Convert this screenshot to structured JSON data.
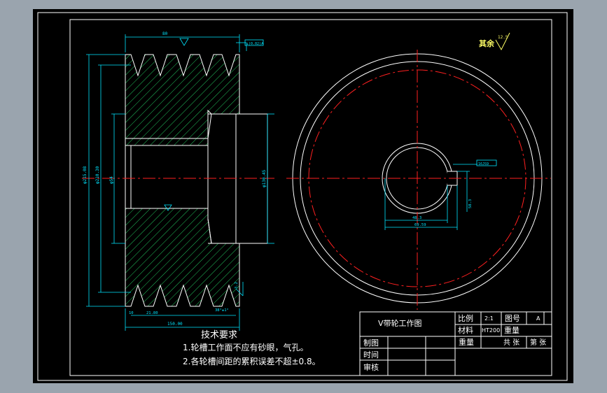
{
  "colors": {
    "background": "#9aa4ae",
    "sheet": "#000000",
    "line": "#ffffff",
    "dimension": "#00e5ff",
    "center": "#ff2020",
    "hatch": "#22c55e",
    "text": "#ffffff"
  },
  "roughness_note": "其余",
  "roughness_value": "12.5",
  "tech_requirements": {
    "title": "技术要求",
    "items": [
      "1.轮槽工作面不应有砂眼，气孔。",
      "2.各轮槽间距的累积误差不超±0.8。"
    ]
  },
  "title_block": {
    "title": "V带轮工作图",
    "scale_label": "比例",
    "scale_value": "2:1",
    "drawing_no_label": "图号",
    "drawing_no_value": "A",
    "material_label": "材料",
    "material_value": "HT200",
    "weight_label": "重量",
    "weight_label_2": "重量",
    "total_sheets": "共 张",
    "sheet_no": "第 张",
    "drawn_label": "制图",
    "date_label": "时间",
    "review_label": "审核"
  },
  "dimensions": {
    "top_width": "80",
    "od": "φ215.08",
    "pitch_d": "φ210.30",
    "hub_d": "φ130.45",
    "bore_d": "φ54",
    "groove_pitch": "21.80",
    "groove_edge": "10",
    "width_total": "150.00",
    "tol_block": "⊥|0.02|A",
    "keyway": "16JS9",
    "keyway_depth": "58.3",
    "key_width": "48.3",
    "key_total": "69.59",
    "groove_angle": "38°±1°",
    "roughness_small": "3.2"
  }
}
